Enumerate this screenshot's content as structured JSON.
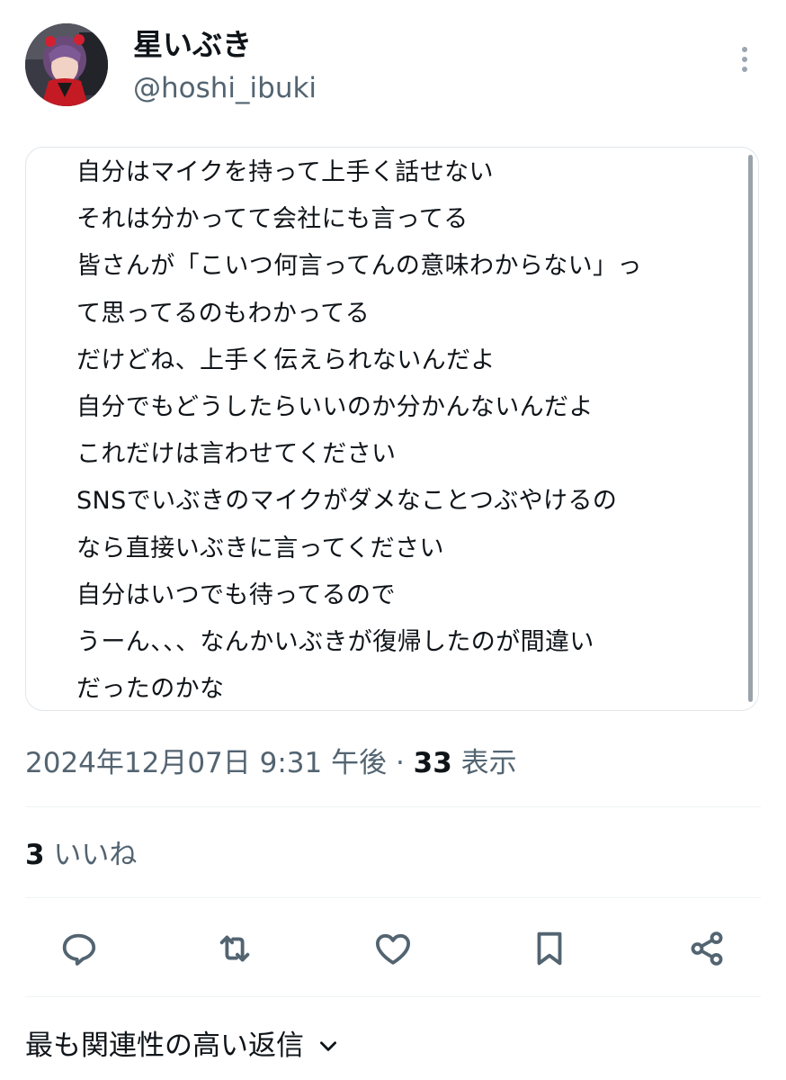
{
  "author": {
    "display_name": "星いぶき",
    "handle": "@hoshi_ibuki"
  },
  "post": {
    "lines": [
      "自分はマイクを持って上手く話せない",
      "それは分かってて会社にも言ってる",
      "皆さんが「こいつ何言ってんの意味わからない」っ",
      "て思ってるのもわかってる",
      "だけどね、上手く伝えられないんだよ",
      "自分でもどうしたらいいのか分かんないんだよ",
      "これだけは言わせてください",
      "SNSでいぶきのマイクがダメなことつぶやけるの",
      "なら直接いぶきに言ってください",
      "自分はいつでも待ってるので",
      "うーん、、、なんかいぶきが復帰したのが間違い",
      "だったのかな"
    ]
  },
  "meta": {
    "timestamp": "2024年12月07日 9:31 午後",
    "separator": " · ",
    "views_count": "33",
    "views_label": " 表示"
  },
  "engagement": {
    "likes_count": "3",
    "likes_label": " いいね"
  },
  "actions": [
    {
      "icon": "reply-icon"
    },
    {
      "icon": "repost-icon"
    },
    {
      "icon": "like-icon"
    },
    {
      "icon": "bookmark-icon"
    },
    {
      "icon": "share-icon"
    }
  ],
  "replies": {
    "sort_label": "最も関連性の高い返信"
  },
  "colors": {
    "text_primary": "#0f1419",
    "text_secondary": "#536471",
    "divider": "#eff3f4"
  }
}
